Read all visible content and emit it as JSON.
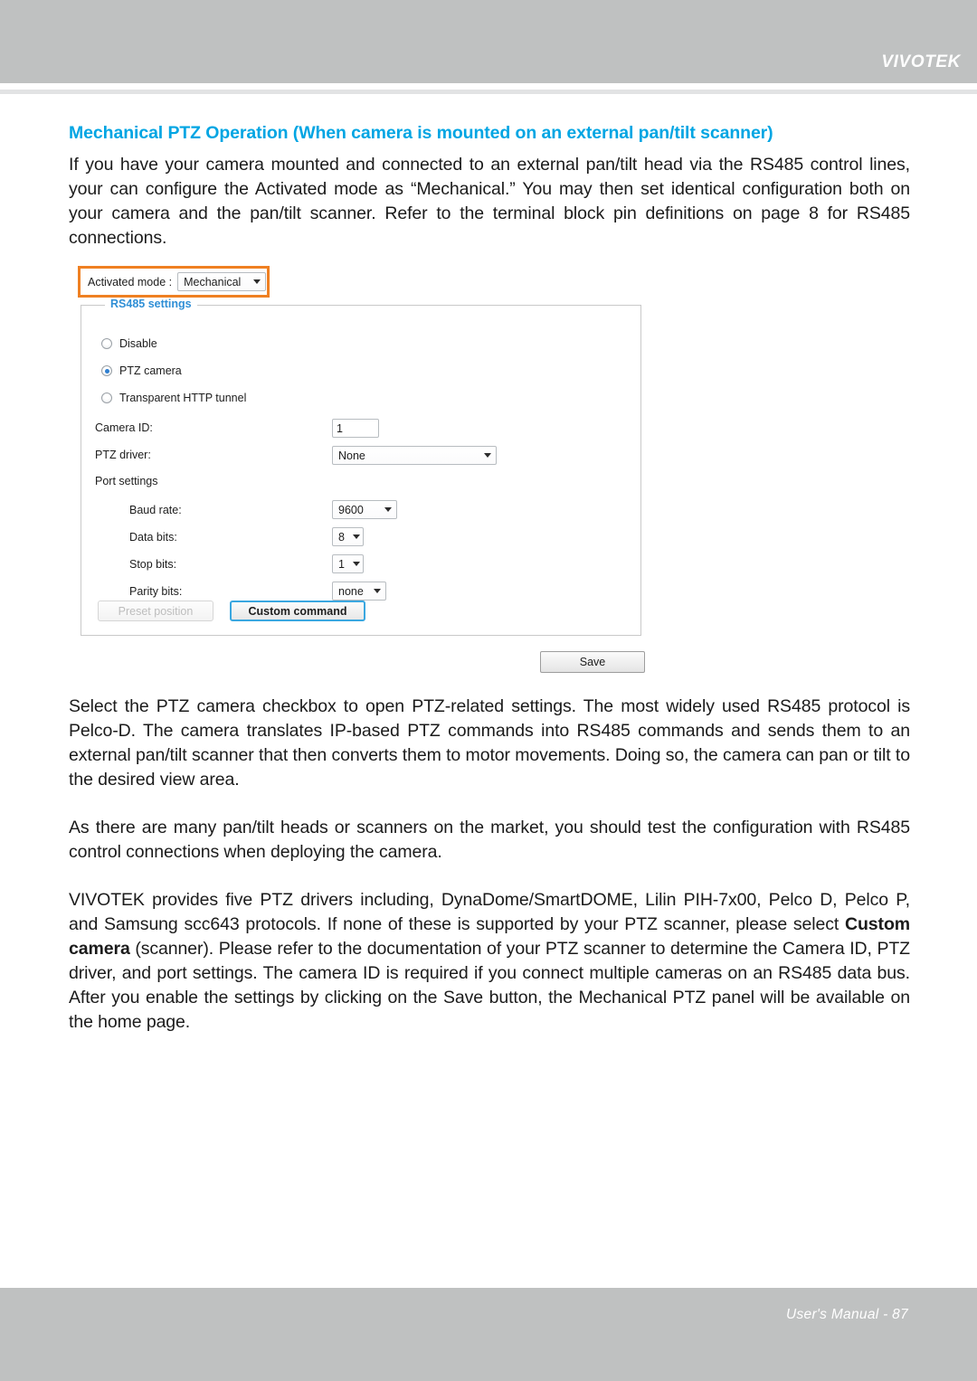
{
  "header": {
    "brand": "VIVOTEK"
  },
  "section": {
    "title": "Mechanical PTZ Operation (When camera is mounted on an external pan/tilt scanner)",
    "paragraph1": "If you have your camera mounted and connected to an external pan/tilt head via the RS485 control lines, your can configure the Activated mode as “Mechanical.” You may then set identical configuration both on your camera and the pan/tilt scanner. Refer to the terminal block pin definitions on page 8 for RS485 connections.",
    "paragraph2": "Select the PTZ camera checkbox to open PTZ-related settings. The most widely used RS485 protocol is Pelco-D. The camera translates IP-based PTZ commands into RS485 commands and sends them to an external pan/tilt scanner that then converts them to motor movements. Doing so, the camera can pan or tilt to the desired view area.",
    "paragraph3": "As there are many pan/tilt heads or scanners on the market, you should test the configuration with RS485 control connections when deploying the camera.",
    "paragraph4_part1": "VIVOTEK provides five PTZ drivers including, DynaDome/SmartDOME, Lilin PIH-7x00, Pelco D, Pelco P, and Samsung scc643 protocols. If none of these is supported by your PTZ scanner, please select ",
    "paragraph4_bold": "Custom camera",
    "paragraph4_part2": " (scanner). Please refer to the documentation of your PTZ scanner to determine the Camera ID, PTZ driver, and port settings. The camera ID is required if you connect multiple cameras on an RS485 data bus. After you enable the settings by clicking on the Save button, the Mechanical PTZ panel will be available on the home page."
  },
  "ui_panel": {
    "activated_mode": {
      "label": "Activated mode :",
      "value": "Mechanical",
      "caret_icon": "chevron-down-icon"
    },
    "fieldset_legend": "RS485 settings",
    "radios": [
      {
        "label": "Disable",
        "checked": false
      },
      {
        "label": "PTZ camera",
        "checked": true
      },
      {
        "label": "Transparent HTTP tunnel",
        "checked": false
      }
    ],
    "camera_id": {
      "label": "Camera ID:",
      "value": "1"
    },
    "ptz_driver": {
      "label": "PTZ driver:",
      "value": "None",
      "caret_icon": "chevron-down-icon"
    },
    "port_settings": {
      "label": "Port settings",
      "fields": [
        {
          "label": "Baud rate:",
          "value": "9600",
          "caret_icon": "chevron-down-icon"
        },
        {
          "label": "Data bits:",
          "value": "8",
          "caret_icon": "chevron-down-icon"
        },
        {
          "label": "Stop bits:",
          "value": "1",
          "caret_icon": "chevron-down-icon"
        },
        {
          "label": "Parity bits:",
          "value": "none",
          "caret_icon": "chevron-down-icon"
        }
      ]
    },
    "buttons": {
      "preset_position": "Preset position",
      "custom_command": "Custom command",
      "save": "Save"
    },
    "colors": {
      "callout_orange": "#ef8022",
      "legend_blue": "#2f8fd6",
      "focus_blue": "#3aa7e0",
      "radio_dot_blue": "#2f7fd0"
    }
  },
  "footer": {
    "text": "User's Manual - 87"
  },
  "theme": {
    "header_gray": "#bfc1c1",
    "title_blue": "#00a5e3",
    "body_black": "#1b1b1b"
  }
}
